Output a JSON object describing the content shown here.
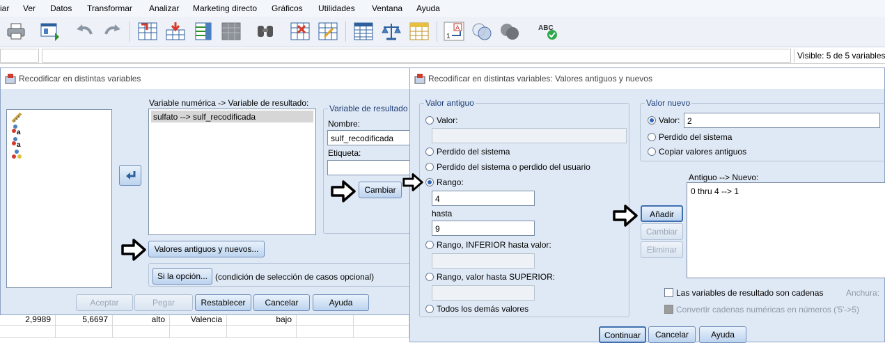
{
  "menubar": {
    "items": [
      "iar",
      "Ver",
      "Datos",
      "Transformar",
      "Analizar",
      "Marketing directo",
      "Gráficos",
      "Utilidades",
      "Ventana",
      "Ayuda"
    ]
  },
  "toolbar": {
    "icons": [
      "print-icon",
      "recall-dialog-icon",
      "undo-icon",
      "redo-icon",
      "goto-case-icon",
      "goto-variable-icon",
      "variables-icon",
      "run-descriptives-icon",
      "find-icon",
      "insert-cases-icon",
      "insert-variable-icon",
      "split-file-icon",
      "weight-cases-icon",
      "select-cases-icon",
      "value-labels-icon",
      "use-sets-icon",
      "show-all-variables-icon",
      "spell-check-icon"
    ]
  },
  "editbar": {
    "visible_text": "Visible: 5 de 5 variables"
  },
  "grid": {
    "row": [
      "2,9989",
      "5,6697",
      "alto",
      "Valencia",
      "bajo"
    ]
  },
  "recode_dialog": {
    "title": "Recodificar en distintas variables",
    "var_list_label": "Variable numérica -> Variable de resultado:",
    "var_list_selected": "sulfato --> sulf_recodificada",
    "output_group_label": "Variable de resultado",
    "nombre_label": "Nombre:",
    "nombre_value": "sulf_recodificada",
    "etiqueta_label": "Etiqueta:",
    "etiqueta_value": "",
    "cambiar_button": "Cambiar",
    "valores_button": "Valores antiguos y nuevos...",
    "si_button": "Si la opción...",
    "si_text": "(condición de selección de casos opcional)",
    "buttons": {
      "aceptar": "Aceptar",
      "pegar": "Pegar",
      "restablecer": "Restablecer",
      "cancelar": "Cancelar",
      "ayuda": "Ayuda"
    }
  },
  "values_dialog": {
    "title": "Recodificar en distintas variables: Valores antiguos y nuevos",
    "old_group_label": "Valor antiguo",
    "old_options": {
      "valor": "Valor:",
      "perdido_sistema": "Perdido del sistema",
      "perdido_usuario": "Perdido del sistema o perdido del usuario",
      "rango": "Rango:",
      "rango_from": "4",
      "hasta": "hasta",
      "rango_to": "9",
      "rango_inferior": "Rango, INFERIOR hasta valor:",
      "rango_superior": "Rango, valor hasta SUPERIOR:",
      "todos": "Todos los demás valores"
    },
    "new_group_label": "Valor nuevo",
    "new_options": {
      "valor": "Valor:",
      "valor_value": "2",
      "perdido_sistema": "Perdido del sistema",
      "copiar": "Copiar valores antiguos"
    },
    "list_label": "Antiguo --> Nuevo:",
    "list_items": [
      "0 thru 4 --> 1"
    ],
    "anadir_button": "Añadir",
    "cambiar_button": "Cambiar",
    "eliminar_button": "Eliminar",
    "cadenas_label": "Las variables de resultado son cadenas",
    "anchura_label": "Anchura:",
    "convertir_label": "Convertir cadenas numéricas en números ('5'->5)",
    "buttons": {
      "continuar": "Continuar",
      "cancelar": "Cancelar",
      "ayuda": "Ayuda"
    }
  },
  "colors": {
    "dialog_bg": "#dfe9f5",
    "group_label": "#1f3e77",
    "button_border": "#6f8db9",
    "radio_on": "#2f63b8"
  }
}
